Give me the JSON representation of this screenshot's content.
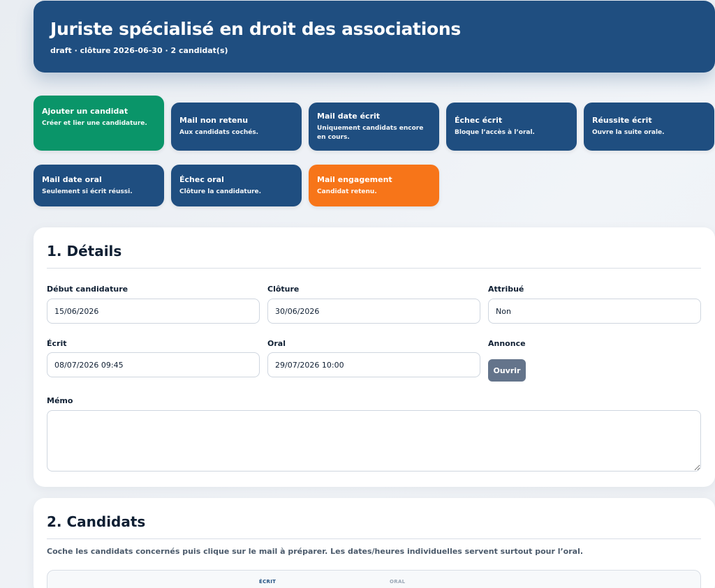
{
  "header": {
    "title": "Juriste spécialisé en droit des associations",
    "subtitle": "draft · clôture 2026-06-30 · 2 candidat(s)"
  },
  "actions": [
    {
      "title": "Ajouter un candidat",
      "desc": "Créer et lier une candidature.",
      "color": "#0a9569"
    },
    {
      "title": "Mail non retenu",
      "desc": "Aux candidats cochés.",
      "color": "#1f4e80"
    },
    {
      "title": "Mail date écrit",
      "desc": "Uniquement candidats encore en cours.",
      "color": "#1f4e80"
    },
    {
      "title": "Échec écrit",
      "desc": "Bloque l’accès à l’oral.",
      "color": "#1f4e80"
    },
    {
      "title": "Réussite écrit",
      "desc": "Ouvre la suite orale.",
      "color": "#1f4e80"
    },
    {
      "title": "Mail date oral",
      "desc": "Seulement si écrit réussi.",
      "color": "#1f4e80"
    },
    {
      "title": "Échec oral",
      "desc": "Clôture la candidature.",
      "color": "#1f4e80"
    },
    {
      "title": "Mail engagement",
      "desc": "Candidat retenu.",
      "color": "#f77519"
    }
  ],
  "details": {
    "title": "1. Détails",
    "debut_label": "Début candidature",
    "debut_value": "15/06/2026",
    "cloture_label": "Clôture",
    "cloture_value": "30/06/2026",
    "attribue_label": "Attribué",
    "attribue_value": "Non",
    "ecrit_label": "Écrit",
    "ecrit_value": "08/07/2026 09:45",
    "oral_label": "Oral",
    "oral_value": "29/07/2026 10:00",
    "annonce_label": "Annonce",
    "annonce_button": "Ouvrir",
    "memo_label": "Mémo",
    "memo_value": ""
  },
  "candidats": {
    "title": "2. Candidats",
    "description": "Coche les candidats concernés puis clique sur le mail à préparer. Les dates/heures individuelles servent surtout pour l’oral.",
    "columns": [
      "ÉCRIT",
      "ORAL"
    ]
  }
}
